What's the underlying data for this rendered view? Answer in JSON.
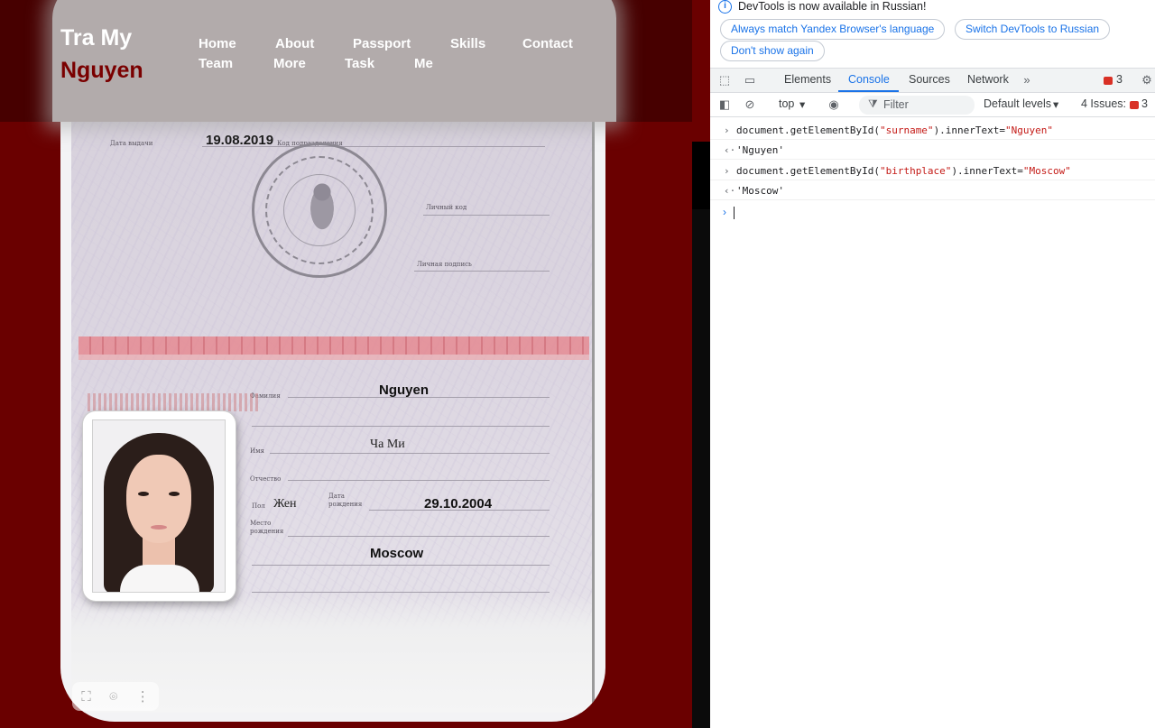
{
  "site": {
    "brand": {
      "first": "Tra My",
      "last": "Nguyen"
    },
    "nav": [
      "Home",
      "About",
      "Passport",
      "Skills",
      "Contact",
      "Team",
      "More",
      "Task",
      "Me"
    ],
    "passport": {
      "issue_date": "19.08.2019",
      "surname": "Nguyen",
      "given_names": "Ча Ми",
      "sex": "Жен",
      "birth_date": "29.10.2004",
      "birthplace": "Moscow",
      "labels": {
        "issue_date": "Дата выдачи",
        "division_code": "Код подразделения",
        "personal_code": "Личный код",
        "signature": "Личная подпись",
        "surname": "Фамилия",
        "name": "Имя",
        "patronymic": "Отчество",
        "sex": "Пол",
        "birth_date": "Дата рождения",
        "birthplace": "Место рождения"
      }
    }
  },
  "devtools": {
    "info_message": "DevTools is now available in Russian!",
    "info_buttons": [
      "Always match Yandex Browser's language",
      "Switch DevTools to Russian",
      "Don't show again"
    ],
    "tabs": [
      "Elements",
      "Console",
      "Sources",
      "Network"
    ],
    "active_tab": "Console",
    "error_count": "3",
    "toolbar": {
      "context": "top",
      "filter_placeholder": "Filter",
      "levels": "Default levels",
      "issues": "4 Issues:",
      "issues_count": "3"
    },
    "console": [
      {
        "kind": "input",
        "prefix": "document.getElementById(",
        "arg": "\"surname\"",
        "mid": ").innerText=",
        "value": "\"Nguyen\""
      },
      {
        "kind": "output",
        "text": "'Nguyen'"
      },
      {
        "kind": "input",
        "prefix": "document.getElementById(",
        "arg": "\"birthplace\"",
        "mid": ").innerText=",
        "value": "\"Moscow\""
      },
      {
        "kind": "output",
        "text": "'Moscow'"
      }
    ],
    "colors": {
      "accent": "#1a73e8",
      "error": "#d93025",
      "string": "#c41a16"
    }
  }
}
